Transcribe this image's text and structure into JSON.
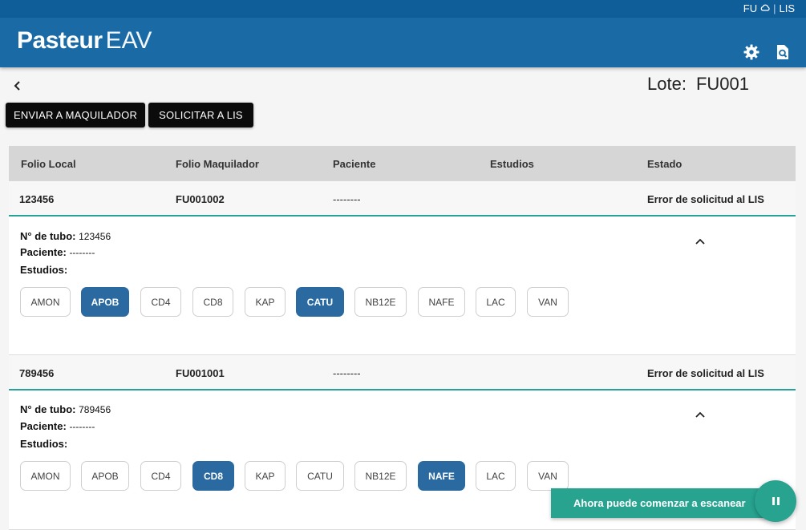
{
  "topbar": {
    "user": "FU",
    "system": "LIS"
  },
  "header": {
    "brand_bold": "Pasteur",
    "brand_light": "EAV"
  },
  "lote": {
    "label": "Lote:",
    "value": "FU001"
  },
  "actions": {
    "send": "ENVIAR A MAQUILADOR",
    "request": "SOLICITAR A LIS"
  },
  "table": {
    "columns": [
      "Folio Local",
      "Folio Maquilador",
      "Paciente",
      "Estudios",
      "Estado"
    ],
    "rows": [
      {
        "folio_local": "123456",
        "folio_maquilador": "FU001002",
        "paciente": "--------",
        "estudios": "",
        "estado": "Error de solicitud al LIS",
        "detail": {
          "tubo_label": "N° de tubo:",
          "tubo": "123456",
          "paciente_label": "Paciente:",
          "paciente": "--------",
          "estudios_label": "Estudios:",
          "chips": [
            {
              "label": "AMON",
              "active": false
            },
            {
              "label": "APOB",
              "active": true
            },
            {
              "label": "CD4",
              "active": false
            },
            {
              "label": "CD8",
              "active": false
            },
            {
              "label": "KAP",
              "active": false
            },
            {
              "label": "CATU",
              "active": true
            },
            {
              "label": "NB12E",
              "active": false
            },
            {
              "label": "NAFE",
              "active": false
            },
            {
              "label": "LAC",
              "active": false
            },
            {
              "label": "VAN",
              "active": false
            }
          ]
        }
      },
      {
        "folio_local": "789456",
        "folio_maquilador": "FU001001",
        "paciente": "--------",
        "estudios": "",
        "estado": "Error de solicitud al LIS",
        "detail": {
          "tubo_label": "N° de tubo:",
          "tubo": "789456",
          "paciente_label": "Paciente:",
          "paciente": "--------",
          "estudios_label": "Estudios:",
          "chips": [
            {
              "label": "AMON",
              "active": false
            },
            {
              "label": "APOB",
              "active": false
            },
            {
              "label": "CD4",
              "active": false
            },
            {
              "label": "CD8",
              "active": true
            },
            {
              "label": "KAP",
              "active": false
            },
            {
              "label": "CATU",
              "active": false
            },
            {
              "label": "NB12E",
              "active": false
            },
            {
              "label": "NAFE",
              "active": true
            },
            {
              "label": "LAC",
              "active": false
            },
            {
              "label": "VAN",
              "active": false
            }
          ]
        }
      }
    ]
  },
  "toast": {
    "message": "Ahora puede comenzar a escanear"
  },
  "colors": {
    "header": "#1a6aa6",
    "topstrip": "#0f5d99",
    "accent": "#27a390",
    "chip_active": "#2b6aa0"
  },
  "icons": [
    "cloud-icon",
    "gear-icon",
    "document-search-icon",
    "back-arrow-icon",
    "chevron-up-icon",
    "pause-icon"
  ]
}
